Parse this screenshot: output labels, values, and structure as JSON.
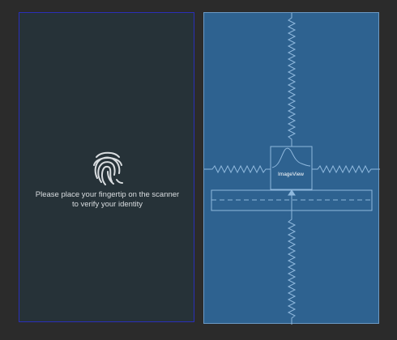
{
  "design": {
    "message_line1": "Please place your fingertip on the scanner",
    "message_line2": "to verify your identity",
    "icon": "fingerprint-icon"
  },
  "blueprint": {
    "imageview_label": "ImageView"
  },
  "colors": {
    "editor_background": "#2b2b2b",
    "design_surface": "#263238",
    "design_border": "#2a2fb8",
    "blueprint_surface": "#2e6290",
    "blueprint_lines": "#8fb8dd",
    "text_light": "#d9dde0"
  }
}
